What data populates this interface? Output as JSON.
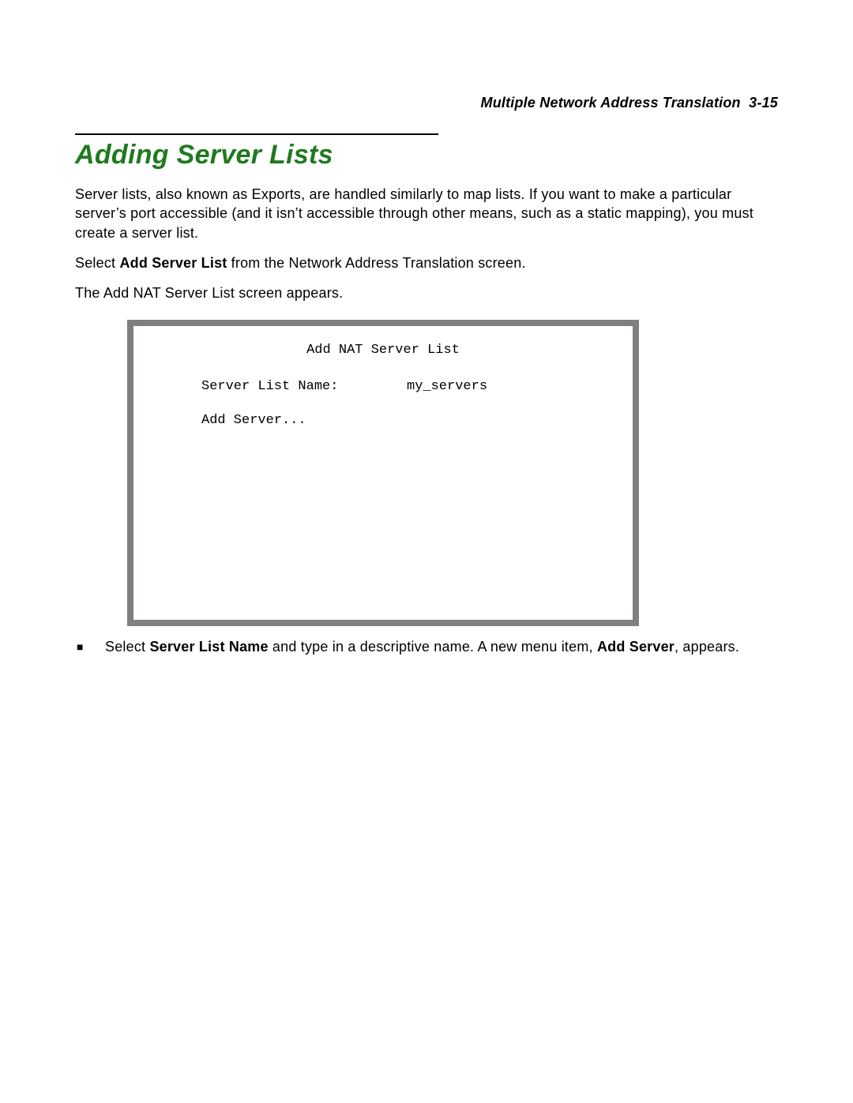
{
  "header": {
    "running_title": "Multiple Network Address Translation",
    "page_ref": "3-15"
  },
  "section": {
    "title": "Adding Server Lists",
    "intro": "Server lists, also known as Exports, are handled similarly to map lists. If you want to make a particular server’s port accessible (and it isn’t accessible through other means, such as a static mapping), you must create a server list.",
    "step1_pre": "Select ",
    "step1_bold": "Add Server List",
    "step1_post": " from the Network Address Translation screen.",
    "step2": "The Add NAT Server List screen appears."
  },
  "terminal": {
    "title": "Add NAT Server List",
    "row1_label": "Server List Name:",
    "row1_value": "my_servers",
    "row2_label": "Add Server..."
  },
  "bullet": {
    "mark": "■",
    "pre": "Select ",
    "bold1": "Server List Name",
    "mid": " and type in a descriptive name. A new menu item, ",
    "bold2": "Add Server",
    "post": ", appears."
  }
}
